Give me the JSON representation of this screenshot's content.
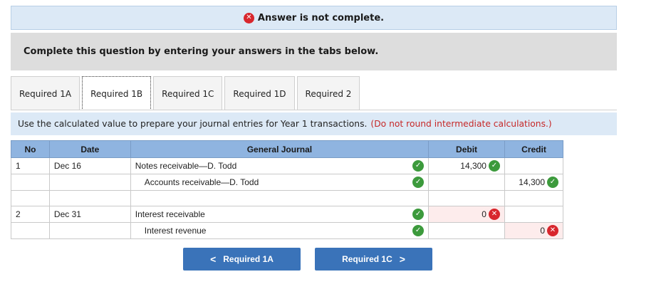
{
  "banner": {
    "text": "Answer is not complete."
  },
  "instruction": "Complete this question by entering your answers in the tabs below.",
  "tabs": [
    {
      "label": "Required 1A"
    },
    {
      "label": "Required 1B"
    },
    {
      "label": "Required 1C"
    },
    {
      "label": "Required 1D"
    },
    {
      "label": "Required 2"
    }
  ],
  "note": {
    "text": "Use the calculated value to prepare your journal entries for Year 1 transactions.",
    "red": "(Do not round intermediate calculations.)"
  },
  "table": {
    "headers": {
      "no": "No",
      "date": "Date",
      "gj": "General Journal",
      "debit": "Debit",
      "credit": "Credit"
    },
    "rows": [
      {
        "no": "1",
        "date": "Dec 16",
        "account": "Notes receivable—D. Todd",
        "debit": "14,300",
        "credit": ""
      },
      {
        "no": "",
        "date": "",
        "account": "Accounts receivable—D. Todd",
        "debit": "",
        "credit": "14,300"
      },
      {
        "no": "",
        "date": "",
        "account": "",
        "debit": "",
        "credit": ""
      },
      {
        "no": "2",
        "date": "Dec 31",
        "account": "Interest receivable",
        "debit": "0",
        "credit": ""
      },
      {
        "no": "",
        "date": "",
        "account": "Interest revenue",
        "debit": "",
        "credit": "0"
      }
    ]
  },
  "nav": {
    "prev_label": "Required 1A",
    "next_label": "Required 1C"
  }
}
